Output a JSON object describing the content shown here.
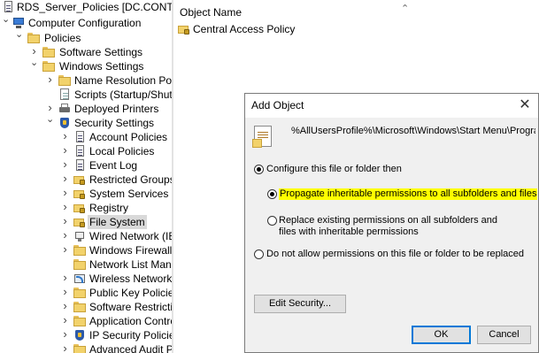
{
  "tree": {
    "items": [
      {
        "label": "RDS_Server_Policies [DC.CONTOSO.C",
        "icon": "policy-icon"
      },
      {
        "label": "Computer Configuration",
        "icon": "computer-icon"
      },
      {
        "label": "Policies",
        "icon": "folder-icon"
      },
      {
        "label": "Software Settings",
        "icon": "folder-icon"
      },
      {
        "label": "Windows Settings",
        "icon": "folder-icon"
      },
      {
        "label": "Name Resolution Policy",
        "icon": "folder-icon"
      },
      {
        "label": "Scripts (Startup/Shutdo",
        "icon": "scripts-icon"
      },
      {
        "label": "Deployed Printers",
        "icon": "printer-icon"
      },
      {
        "label": "Security Settings",
        "icon": "security-settings-icon"
      },
      {
        "label": "Account Policies",
        "icon": "policy-icon"
      },
      {
        "label": "Local Policies",
        "icon": "policy-icon"
      },
      {
        "label": "Event Log",
        "icon": "policy-icon"
      },
      {
        "label": "Restricted Groups",
        "icon": "lock-folder-icon"
      },
      {
        "label": "System Services",
        "icon": "lock-folder-icon"
      },
      {
        "label": "Registry",
        "icon": "lock-folder-icon"
      },
      {
        "label": "File System",
        "icon": "lock-folder-icon"
      },
      {
        "label": "Wired Network (IEEE",
        "icon": "wired-network-icon"
      },
      {
        "label": "Windows Firewall w",
        "icon": "folder-icon"
      },
      {
        "label": "Network List Manag",
        "icon": "folder-icon"
      },
      {
        "label": "Wireless Network (II",
        "icon": "wireless-network-icon"
      },
      {
        "label": "Public Key Policies",
        "icon": "folder-icon"
      },
      {
        "label": "Software Restrictio",
        "icon": "folder-icon"
      },
      {
        "label": "Application Control",
        "icon": "folder-icon"
      },
      {
        "label": "IP Security Policies c",
        "icon": "ip-security-icon"
      },
      {
        "label": "Advanced Audit Po",
        "icon": "folder-icon"
      }
    ],
    "selected": "File System"
  },
  "list": {
    "column_header": "Object Name",
    "items": [
      {
        "label": "Central Access Policy",
        "icon": "lock-folder-icon"
      }
    ]
  },
  "dialog": {
    "title": "Add Object",
    "close_glyph": "✕",
    "path": "%AllUsersProfile%\\Microsoft\\Windows\\Start Menu\\Programs\\Sen",
    "options": {
      "configure": "Configure this file or folder then",
      "propagate": "Propagate inheritable permissions to all subfolders and files",
      "replace": "Replace existing permissions on all subfolders and files with inheritable permissions",
      "do_not_allow": "Do not allow permissions on this file or folder to be replaced"
    },
    "selected_option": "propagate",
    "edit_security_label": "Edit Security...",
    "ok_label": "OK",
    "cancel_label": "Cancel",
    "highlight_color": "#ffff00"
  }
}
